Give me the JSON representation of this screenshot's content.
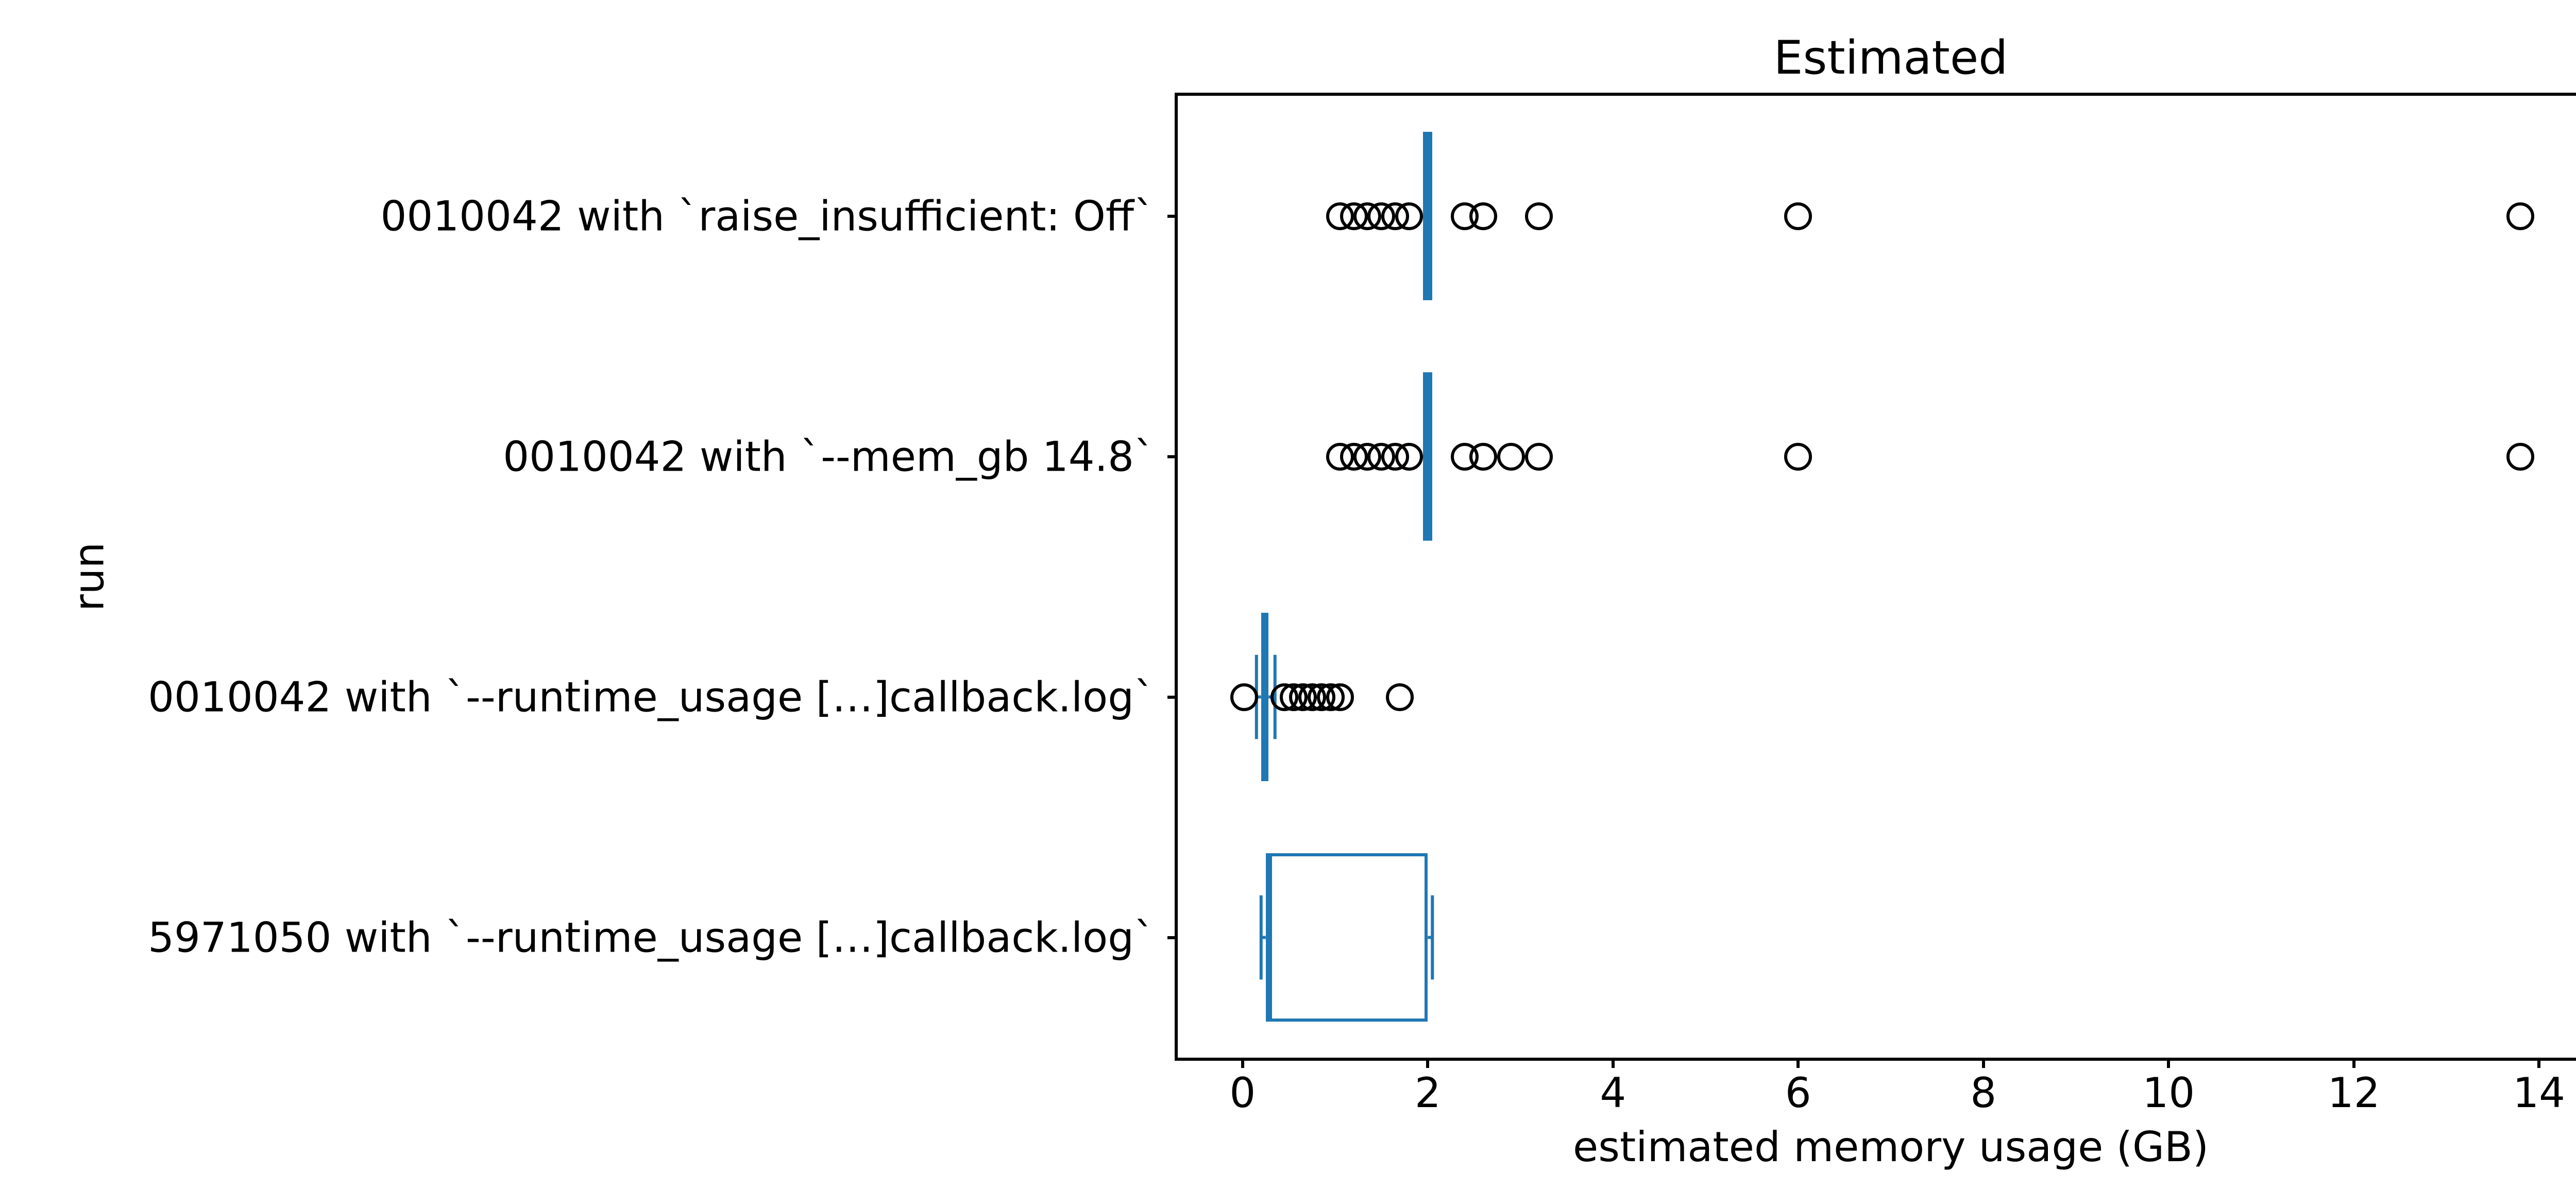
{
  "chart_data": {
    "type": "boxplot-horizontal",
    "title": "Estimated",
    "xlabel": "estimated memory usage (GB)",
    "ylabel": "run",
    "xlim": [
      -0.7,
      14.7
    ],
    "xticks": [
      0,
      2,
      4,
      6,
      8,
      10,
      12,
      14
    ],
    "categories": [
      "0010042 with `raise_insufficient: Off`",
      "0010042 with `--mem_gb 14.8`",
      "0010042 with `--runtime_usage […]callback.log`",
      "5971050 with `--runtime_usage […]callback.log`"
    ],
    "series": [
      {
        "name": "0010042 with `raise_insufficient: Off`",
        "q1": 1.95,
        "median": 2.0,
        "q3": 2.05,
        "whisker_low": 1.95,
        "whisker_high": 2.05,
        "fliers": [
          1.05,
          1.2,
          1.35,
          1.5,
          1.65,
          1.8,
          2.4,
          2.6,
          3.2,
          6.0,
          13.8
        ]
      },
      {
        "name": "0010042 with `--mem_gb 14.8`",
        "q1": 1.95,
        "median": 2.0,
        "q3": 2.05,
        "whisker_low": 1.95,
        "whisker_high": 2.05,
        "fliers": [
          1.05,
          1.2,
          1.35,
          1.5,
          1.65,
          1.8,
          2.4,
          2.6,
          2.9,
          3.2,
          6.0,
          13.8
        ]
      },
      {
        "name": "0010042 with `--runtime_usage […]callback.log`",
        "q1": 0.2,
        "median": 0.23,
        "q3": 0.28,
        "whisker_low": 0.15,
        "whisker_high": 0.35,
        "fliers": [
          0.02,
          0.45,
          0.55,
          0.65,
          0.75,
          0.85,
          0.95,
          1.05,
          1.7
        ]
      },
      {
        "name": "5971050 with `--runtime_usage […]callback.log`",
        "q1": 0.25,
        "median": 0.3,
        "q3": 2.0,
        "whisker_low": 0.2,
        "whisker_high": 2.05,
        "fliers": []
      }
    ]
  },
  "colors": {
    "box": "#1f77b4",
    "median": "#1f77b4",
    "flier_edge": "#000000"
  }
}
